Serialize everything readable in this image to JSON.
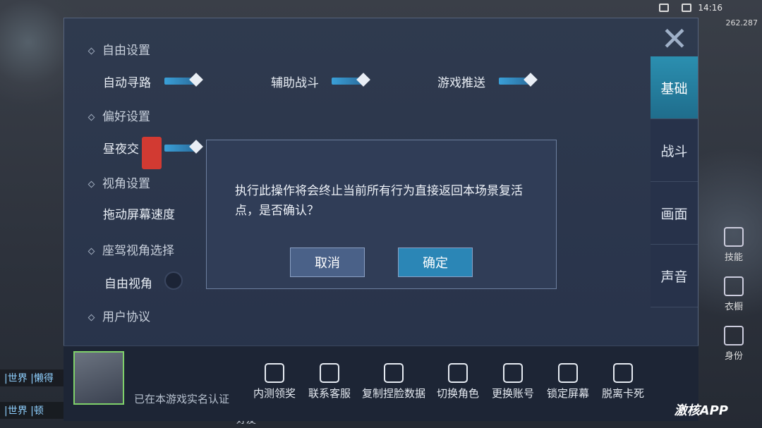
{
  "status": {
    "time": "14:16",
    "ping": "262.287"
  },
  "background": {
    "chat1": "|世界 |懒得",
    "chat2": "|世界 |顿",
    "hud": [
      "技能",
      "衣橱",
      "身份"
    ],
    "friend": "好友"
  },
  "tabs": [
    "基础",
    "战斗",
    "画面",
    "声音"
  ],
  "sections": {
    "free": "自由设置",
    "pref": "偏好设置",
    "view": "视角设置",
    "seat": "座驾视角选择",
    "agreement": "用户协议"
  },
  "labels": {
    "auto_path": "自动寻路",
    "assist_fight": "辅助战斗",
    "game_push": "游戏推送",
    "day_night": "昼夜交",
    "drag_speed": "拖动屏幕速度",
    "free_view": "自由视角"
  },
  "bottom": {
    "realname": "已在本游戏实名认证",
    "actions": [
      "内测领奖",
      "联系客服",
      "复制捏脸数据",
      "切换角色",
      "更换账号",
      "锁定屏幕",
      "脱离卡死"
    ]
  },
  "dialog": {
    "message": "执行此操作将会终止当前所有行为直接返回本场景复活点，是否确认？",
    "cancel": "取消",
    "confirm": "确定"
  },
  "watermark": "激核APP"
}
